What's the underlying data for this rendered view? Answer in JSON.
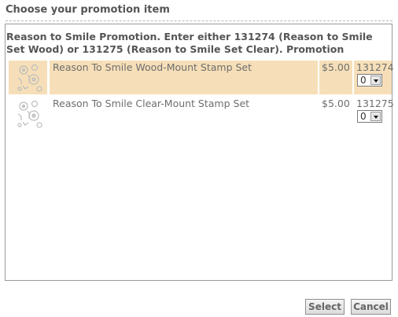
{
  "dialog": {
    "title": "Choose your promotion item"
  },
  "promotion": {
    "description": "Reason to Smile Promotion. Enter either 131274 (Reason to Smile Set Wood) or 131275 (Reason to Smile Set Clear). Promotion"
  },
  "items": [
    {
      "name": "Reason To Smile Wood-Mount Stamp Set",
      "price": "$5.00",
      "sku": "131274",
      "quantity": "0",
      "highlighted": true,
      "thumbnail_icon": "flower-stamp-icon"
    },
    {
      "name": "Reason To Smile Clear-Mount Stamp Set",
      "price": "$5.00",
      "sku": "131275",
      "quantity": "0",
      "highlighted": false,
      "thumbnail_icon": "flower-stamp-icon"
    }
  ],
  "buttons": {
    "select_label": "Select",
    "cancel_label": "Cancel"
  },
  "colors": {
    "highlight": "#f6dfb8",
    "text": "#6e6e6e",
    "title": "#555555"
  }
}
